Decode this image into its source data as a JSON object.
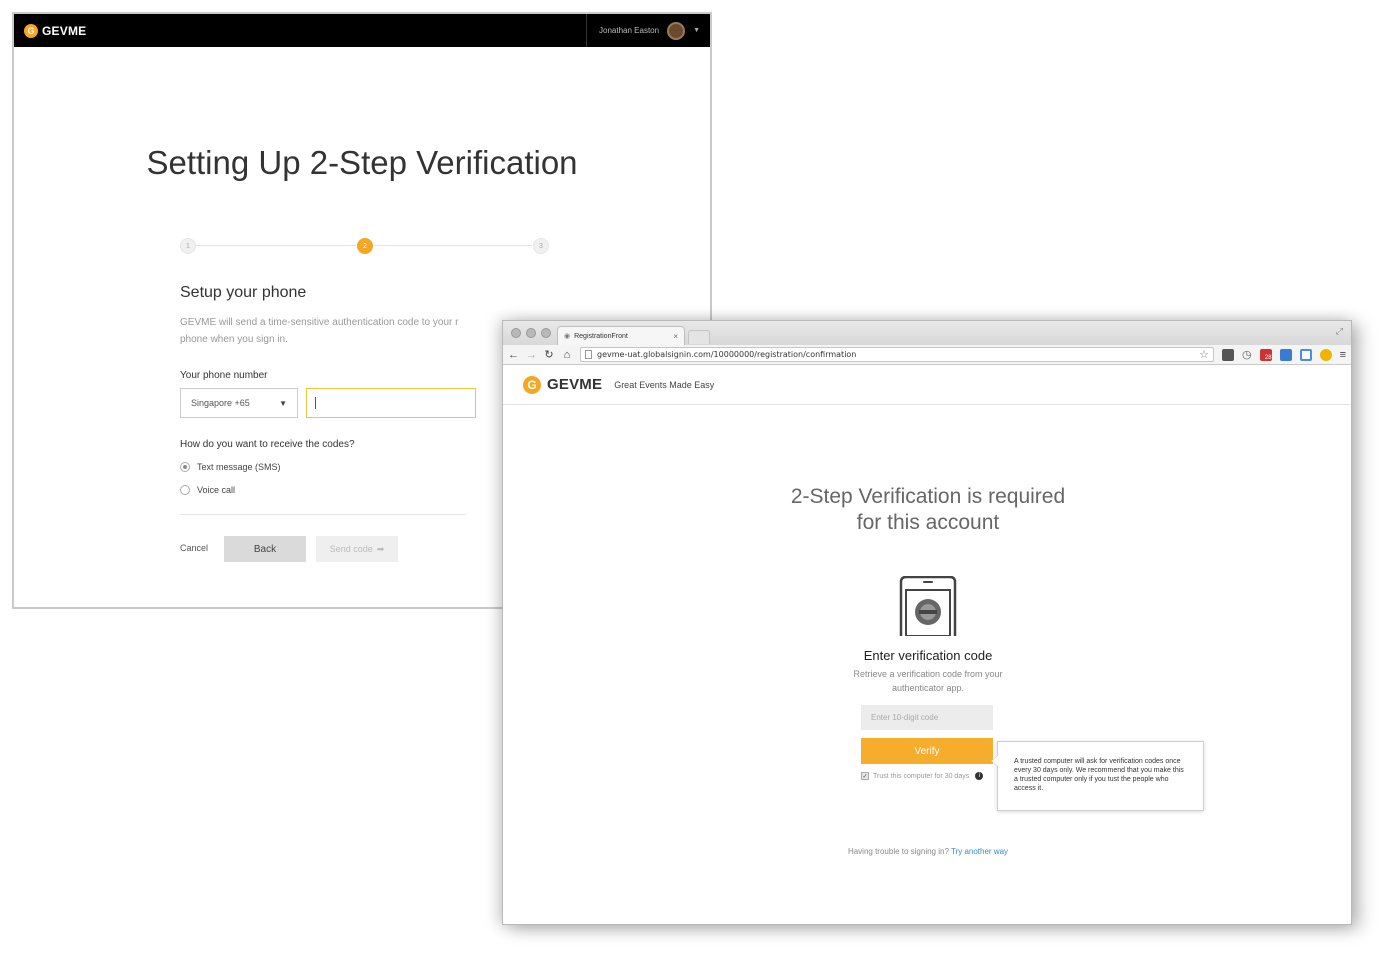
{
  "back_window": {
    "brand": "GEVME",
    "logo_letter": "G",
    "user_name": "Jonathan Easton",
    "title": "Setting Up 2-Step Verification",
    "steps": [
      "1",
      "2",
      "3"
    ],
    "active_step": 2,
    "section_title": "Setup your phone",
    "section_desc": "GEVME will send a time-sensitive authentication code to your r phone when you sign in.",
    "phone_label": "Your phone number",
    "country_value": "Singapore +65",
    "phone_value": "",
    "receive_label": "How do you want to receive the codes?",
    "options": [
      {
        "label": "Text message (SMS)",
        "selected": true
      },
      {
        "label": "Voice call",
        "selected": false
      }
    ],
    "cancel_label": "Cancel",
    "back_label": "Back",
    "send_label": "Send code"
  },
  "browser": {
    "tab_title": "RegistrationFront",
    "url": "gevme-uat.globalsignin.com/10000000/registration/confirmation",
    "extensions": [
      "#555555",
      "#777777",
      "#cc3333",
      "#3b7bd1",
      "#4a90d9",
      "#f0b400"
    ],
    "gmail_badge": "28"
  },
  "front_page": {
    "brand": "GEVME",
    "logo_letter": "G",
    "tagline": "Great Events Made Easy",
    "title_line1": "2-Step Verification is required",
    "title_line2": "for this account",
    "enter_title": "Enter verification code",
    "enter_desc": "Retrieve a verification code from your authenticator app.",
    "code_placeholder": "Enter 10-digit code",
    "verify_label": "Verify",
    "trust_label": "Trust this computer for 30 days",
    "trust_checked": true,
    "tooltip": "A trusted computer will ask for verification codes once every 30 days only. We recommend that you make this a trusted computer only if you tust the people who access it.",
    "trouble_text": "Having trouble to signing in?",
    "trouble_link": "Try another way"
  },
  "colors": {
    "accent": "#f5a623",
    "link": "#3a8ccf"
  }
}
